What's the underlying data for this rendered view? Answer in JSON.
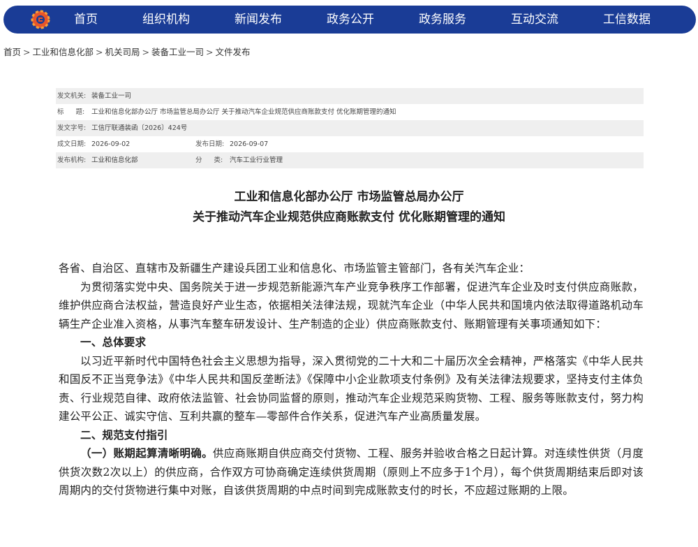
{
  "nav": {
    "items": [
      "首页",
      "组织机构",
      "新闻发布",
      "政务公开",
      "政务服务",
      "互动交流",
      "工信数据"
    ]
  },
  "breadcrumb": {
    "items": [
      "首页",
      "工业和信息化部",
      "机关司局",
      "装备工业一司",
      "文件发布"
    ],
    "separator": ">"
  },
  "meta": {
    "issuer_label": "发文机关:",
    "issuer": "装备工业一司",
    "title_label": "标 题:",
    "title": "工业和信息化部办公厅 市场监管总局办公厅 关于推动汽车企业规范供应商账款支付 优化账期管理的通知",
    "docno_label": "发文字号:",
    "docno": "工信厅联通装函〔2026〕424号",
    "created_label": "成文日期:",
    "created": "2026-09-02",
    "published_label": "发布日期:",
    "published": "2026-09-07",
    "org_label": "发布机构:",
    "org": "工业和信息化部",
    "category_label": "分 类:",
    "category": "汽车工业行业管理"
  },
  "doc": {
    "title_line1": "工业和信息化部办公厅 市场监管总局办公厅",
    "title_line2": "关于推动汽车企业规范供应商账款支付 优化账期管理的通知",
    "salutation": "各省、自治区、直辖市及新疆生产建设兵团工业和信息化、市场监管主管部门，各有关汽车企业：",
    "intro": "为贯彻落实党中央、国务院关于进一步规范新能源汽车产业竞争秩序工作部署，促进汽车企业及时支付供应商账款，维护供应商合法权益，营造良好产业生态，依据相关法律法规，现就汽车企业（中华人民共和国境内依法取得道路机动车辆生产企业准入资格，从事汽车整车研发设计、生产制造的企业）供应商账款支付、账期管理有关事项通知如下：",
    "h1": "一、总体要求",
    "p1": "以习近平新时代中国特色社会主义思想为指导，深入贯彻党的二十大和二十届历次全会精神，严格落实《中华人民共和国反不正当竞争法》《中华人民共和国反垄断法》《保障中小企业款项支付条例》及有关法律法规要求，坚持支付主体负责、行业规范自律、政府依法监管、社会协同监督的原则，推动汽车企业规范采购货物、工程、服务等账款支付，努力构建公平公正、诚实守信、互利共赢的整车—零部件合作关系，促进汽车产业高质量发展。",
    "h2": "二、规范支付指引",
    "p2_lead": "（一）账期起算清晰明确。",
    "p2": "供应商账期自供应商交付货物、工程、服务并验收合格之日起计算。对连续性供货（月度供货次数2次以上）的供应商，合作双方可协商确定连续供货周期（原则上不应多于1个月），每个供货周期结束后即对该周期内的交付货物进行集中对账，自该供货周期的中点时间到完成账款支付的时长，不应超过账期的上限。"
  }
}
